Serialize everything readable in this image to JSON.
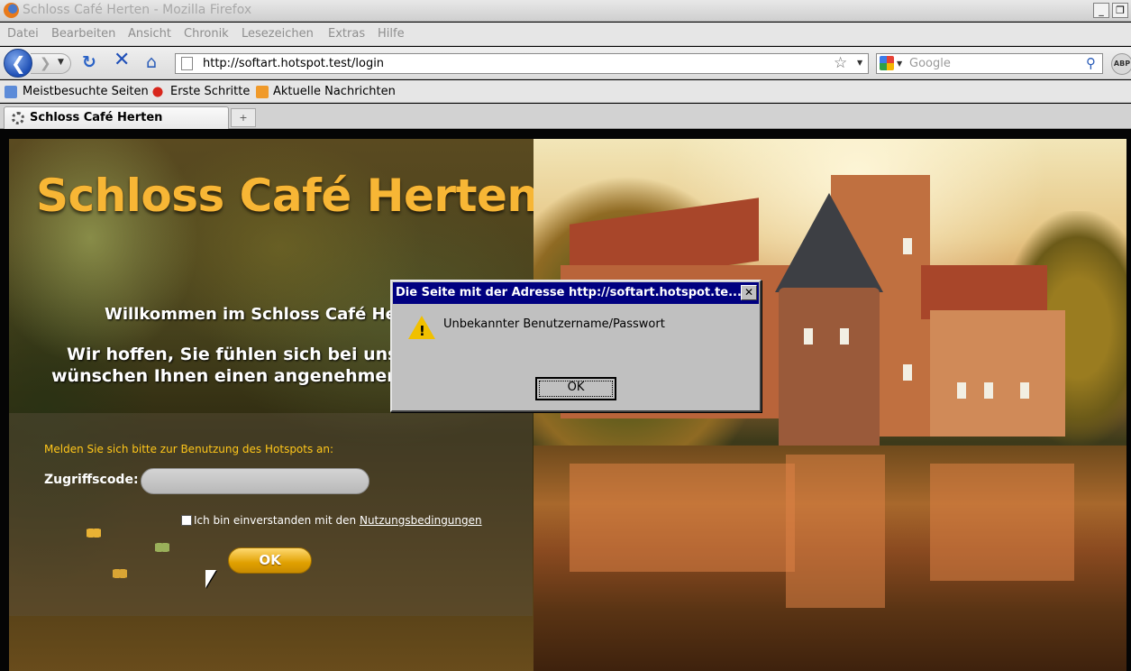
{
  "window": {
    "title": "Schloss Café Herten - Mozilla Firefox",
    "minimize_glyph": "_",
    "restore_glyph": "❐"
  },
  "menu": [
    "Datei",
    "Bearbeiten",
    "Ansicht",
    "Chronik",
    "Lesezeichen",
    "Extras",
    "Hilfe"
  ],
  "navigation": {
    "url": "http://softart.hotspot.test/login",
    "search_placeholder": "Google",
    "addon_label": "ABP"
  },
  "bookmarks": [
    "Meistbesuchte Seiten",
    "Erste Schritte",
    "Aktuelle Nachrichten"
  ],
  "tabs": [
    {
      "label": "Schloss Café Herten",
      "loading": true
    }
  ],
  "page": {
    "logo": "Schloss Café Herten",
    "welcome_line1": "Willkommen im Schloss Café He",
    "welcome_line2": "Wir hoffen, Sie fühlen sich bei uns w",
    "welcome_line3": "wünschen Ihnen einen angenehmen",
    "login_prompt": "Melden Sie sich bitte zur Benutzung des Hotspots an:",
    "code_label": "Zugriffscode:",
    "code_value": "",
    "agree_text": "Ich bin einverstanden mit den ",
    "agree_link": "Nutzungsbedingungen",
    "agree_checked": false,
    "ok_button": "OK"
  },
  "dialog": {
    "title": "Die Seite mit der Adresse http://softart.hotspot.te...",
    "close_glyph": "✕",
    "message": "Unbekannter Benutzername/Passwort",
    "ok_button": "OK"
  },
  "colors": {
    "logo": "#f7b635",
    "login_prompt": "#ffc61a",
    "dialog_title_bar": "#000080",
    "dialog_body": "#c0c0c0"
  }
}
